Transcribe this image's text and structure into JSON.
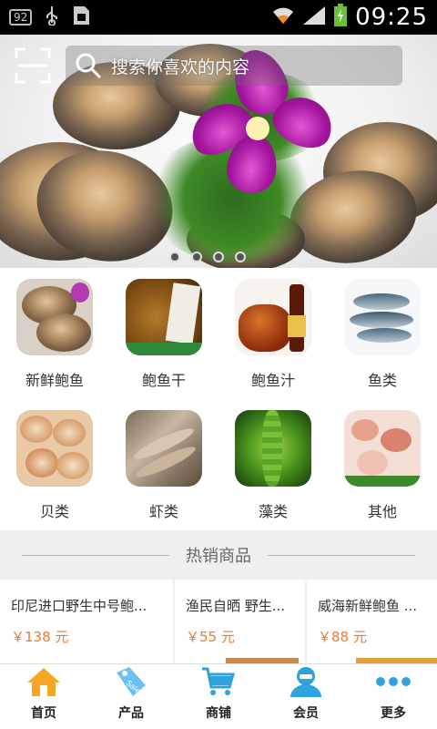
{
  "status_bar": {
    "badge": "92",
    "time": "09:25",
    "icons": [
      "usb-icon",
      "sim-icon",
      "wifi-icon",
      "signal-icon",
      "battery-icon"
    ]
  },
  "search": {
    "placeholder": "搜索你喜欢的内容",
    "scan_icon": "scan-icon"
  },
  "banner": {
    "slides": 4,
    "active_index": 3
  },
  "categories": [
    {
      "label": "新鲜鲍鱼",
      "icon": "fresh-abalone-image"
    },
    {
      "label": "鲍鱼干",
      "icon": "dried-abalone-image"
    },
    {
      "label": "鲍鱼汁",
      "icon": "abalone-sauce-image"
    },
    {
      "label": "鱼类",
      "icon": "fish-image"
    },
    {
      "label": "贝类",
      "icon": "shellfish-image"
    },
    {
      "label": "虾类",
      "icon": "shrimp-image"
    },
    {
      "label": "藻类",
      "icon": "seaweed-image"
    },
    {
      "label": "其他",
      "icon": "other-seafood-image"
    }
  ],
  "hot_sale": {
    "title": "热销商品"
  },
  "products": [
    {
      "name": "印尼进口野生中号鲍...",
      "price": "￥138 元"
    },
    {
      "name": "渔民自晒 野生...",
      "price": "￥55 元"
    },
    {
      "name": "威海新鲜鲍鱼 ...",
      "price": "￥88 元"
    }
  ],
  "tabs": [
    {
      "label": "首页",
      "icon": "home-icon"
    },
    {
      "label": "产品",
      "icon": "tag-icon"
    },
    {
      "label": "商铺",
      "icon": "cart-icon"
    },
    {
      "label": "会员",
      "icon": "user-icon"
    },
    {
      "label": "更多",
      "icon": "more-icon"
    }
  ],
  "colors": {
    "accent_orange": "#f07a2a",
    "tab_blue": "#2ea3de",
    "home_orange": "#f5a623"
  }
}
